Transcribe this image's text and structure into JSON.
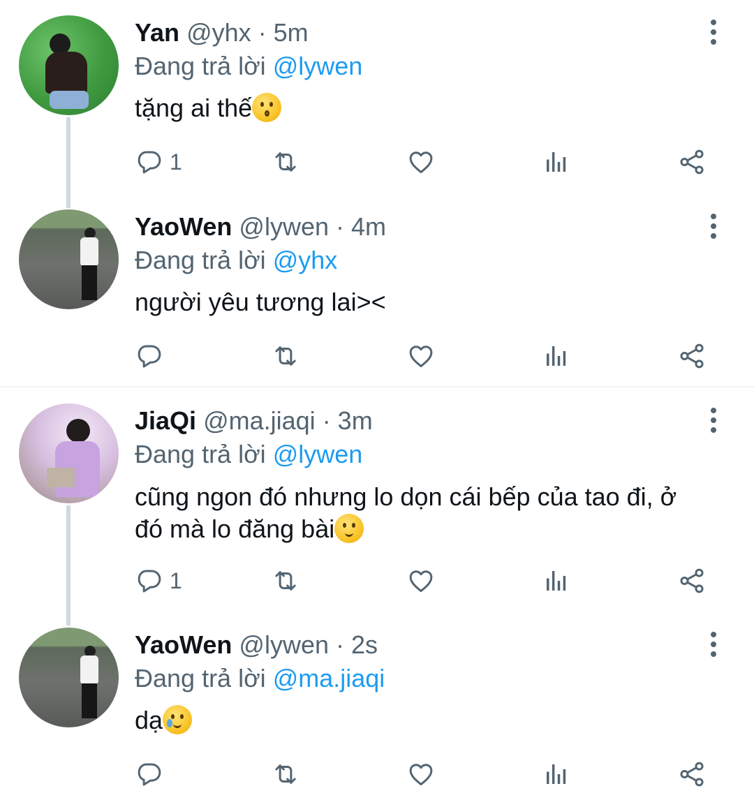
{
  "tweets": [
    {
      "name": "Yan",
      "handle": "@yhx",
      "time": "· 5m",
      "replying_prefix": "Đang trả lời",
      "replying_to": "@lywen",
      "text": "tặng ai thế",
      "emoji": "kissing-face",
      "reply_count": "1"
    },
    {
      "name": "YaoWen",
      "handle": "@lywen",
      "time": "· 4m",
      "replying_prefix": "Đang trả lời",
      "replying_to": "@yhx",
      "text": "người yêu tương lai><",
      "reply_count": ""
    },
    {
      "name": "JiaQi",
      "handle": "@ma.jiaqi",
      "time": "· 3m",
      "replying_prefix": "Đang trả lời",
      "replying_to": "@lywen",
      "text_line1": "cũng ngon đó nhưng lo dọn cái bếp của tao đi, ở",
      "text_line2": "đó mà lo đăng bài",
      "emoji": "slightly-smiling-face",
      "reply_count": "1"
    },
    {
      "name": "YaoWen",
      "handle": "@lywen",
      "time": "· 2s",
      "replying_prefix": "Đang trả lời",
      "replying_to": "@ma.jiaqi",
      "text": "dạ",
      "emoji": "smiling-face-with-tear",
      "reply_count": ""
    }
  ],
  "icons": [
    "reply-icon",
    "retweet-icon",
    "like-icon",
    "views-icon",
    "share-icon",
    "more-options-icon"
  ],
  "colors": {
    "mention": "#1d9bf0",
    "muted": "#536471",
    "thread_line": "#cfd9de"
  }
}
